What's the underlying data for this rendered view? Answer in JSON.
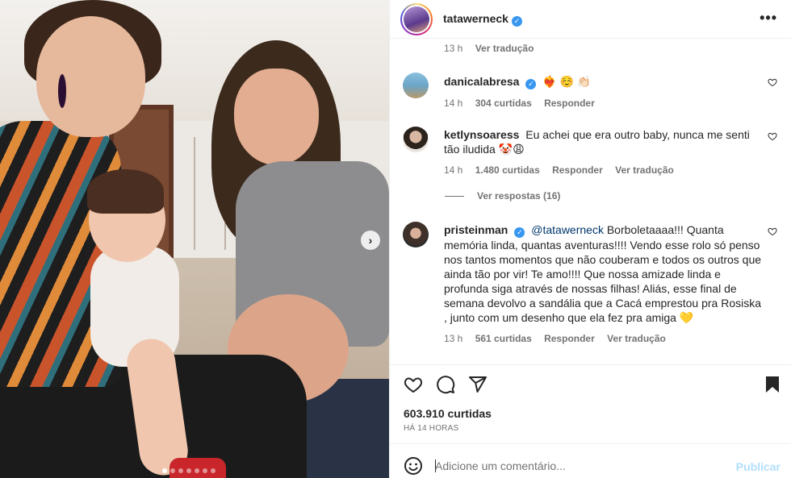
{
  "post": {
    "author": "tatawerneck",
    "more_icon": "more-horizontal-icon",
    "carousel_dots": 7,
    "carousel_active": 0
  },
  "top_meta": {
    "time": "13 h",
    "translate": "Ver tradução"
  },
  "comments": [
    {
      "username": "danicalabresa",
      "verified": true,
      "text": "❤️‍🔥 ☺️ 👏🏻",
      "time": "14 h",
      "likes": "304 curtidas",
      "reply": "Responder",
      "translate": ""
    },
    {
      "username": "ketlynsoaress",
      "verified": false,
      "text": "Eu achei que era outro baby, nunca me senti tão iludida 🤡😩",
      "time": "14 h",
      "likes": "1.480 curtidas",
      "reply": "Responder",
      "translate": "Ver tradução"
    },
    {
      "username": "pristeinman",
      "verified": true,
      "mention": "@tatawerneck",
      "text": " Borboletaaaa!!! Quanta memória linda, quantas aventuras!!!! Vendo esse rolo só penso nos tantos momentos que não couberam e todos os outros que ainda tão por vir! Te amo!!!! Que nossa amizade linda e profunda siga através de nossas filhas! Aliás, esse final de semana devolvo a sandália que a Cacá emprestou pra Rosiska , junto com um desenho que ela fez pra amiga 💛",
      "time": "13 h",
      "likes": "561 curtidas",
      "reply": "Responder",
      "translate": "Ver tradução"
    }
  ],
  "view_replies": "Ver respostas (16)",
  "likes_count": "603.910 curtidas",
  "time_ago": "HÁ 14 HORAS",
  "add_comment": {
    "placeholder": "Adicione um comentário...",
    "post_label": "Publicar"
  },
  "colors": {
    "verified": "#3897f0",
    "muted": "#737373",
    "text": "#262626",
    "post_disabled": "#b2dffc",
    "mention": "#00376b"
  }
}
